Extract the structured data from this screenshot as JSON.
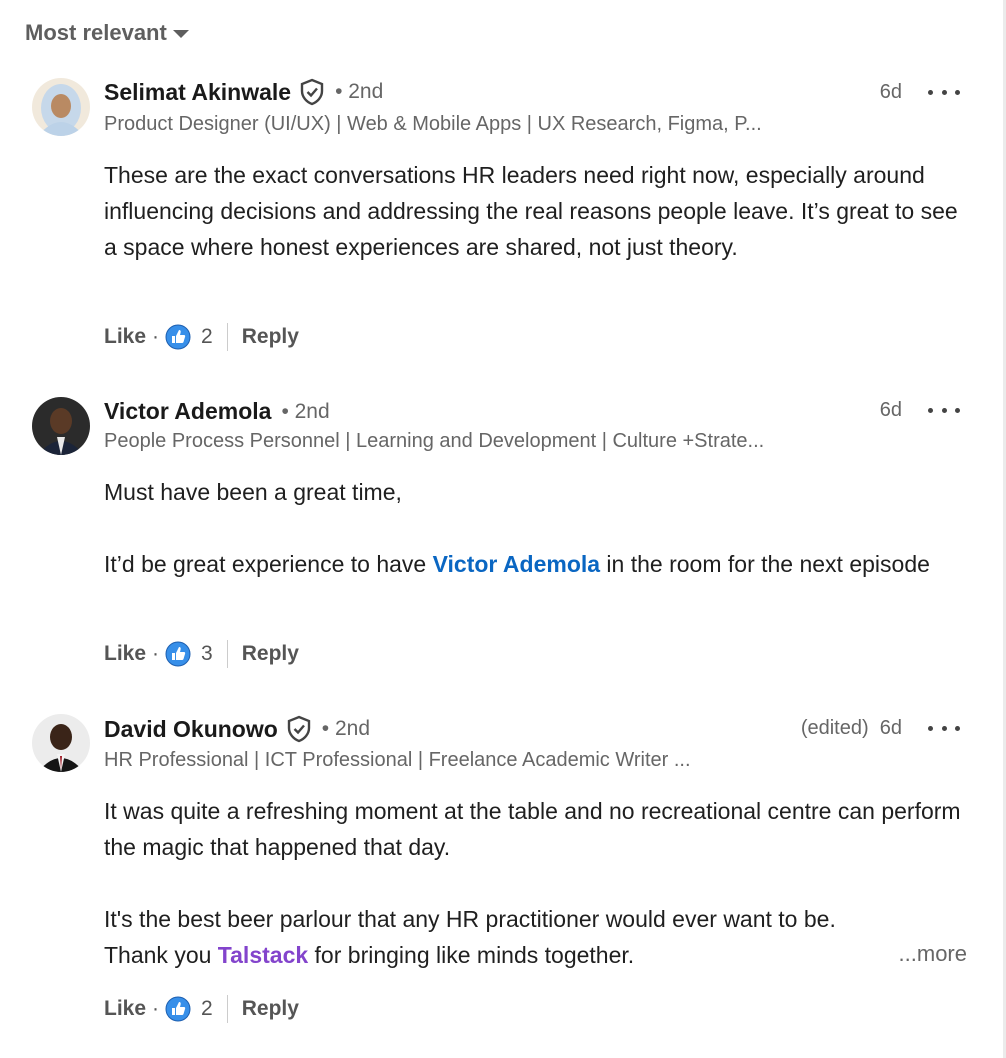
{
  "sort": {
    "label": "Most relevant"
  },
  "comments": [
    {
      "author": "Selimat Akinwale",
      "degree": "• 2nd",
      "headline": "Product Designer (UI/UX) | Web & Mobile Apps | UX Research, Figma, P...",
      "edited": "",
      "time": "6d",
      "body_lines": [
        "These are the exact conversations HR leaders need right now, especially around influencing decisions and addressing the real reasons people leave. It’s great to see a space where honest experiences are shared, not just theory."
      ],
      "like_label": "Like",
      "reaction_count": "2",
      "reply_label": "Reply"
    },
    {
      "author": "Victor Ademola",
      "degree": "• 2nd",
      "headline": "People Process Personnel | Learning and Development | Culture +Strate...",
      "time": "6d",
      "p1": "Must have been a great time,",
      "p2_before": "It’d be great experience to have ",
      "p2_mention": "Victor Ademola",
      "p2_after": " in the room for the next episode",
      "like_label": "Like",
      "reaction_count": "3",
      "reply_label": "Reply"
    },
    {
      "author": "David Okunowo",
      "degree": "• 2nd",
      "headline": "HR Professional | ICT Professional | Freelance Academic Writer ...",
      "edited": "(edited)",
      "time": "6d",
      "p1": "It was quite a refreshing moment at the table and no recreational centre can perform the magic that happened that day.",
      "p2_line1": "It's the best beer parlour that any HR practitioner would ever want to be.",
      "p2_before": "Thank you ",
      "p2_company": "Talstack",
      "p2_after": " for bringing like minds together.",
      "more_label": "...more",
      "like_label": "Like",
      "reaction_count": "2",
      "reply_label": "Reply"
    }
  ],
  "colors": {
    "mention": "#0a66c2",
    "company_mention": "#8344cc",
    "reaction": "#378fe9"
  },
  "icons": {
    "verified": "verified-shield-icon",
    "reaction": "like-reaction-icon",
    "menu": "more-options-icon",
    "sort": "caret-down-icon"
  }
}
